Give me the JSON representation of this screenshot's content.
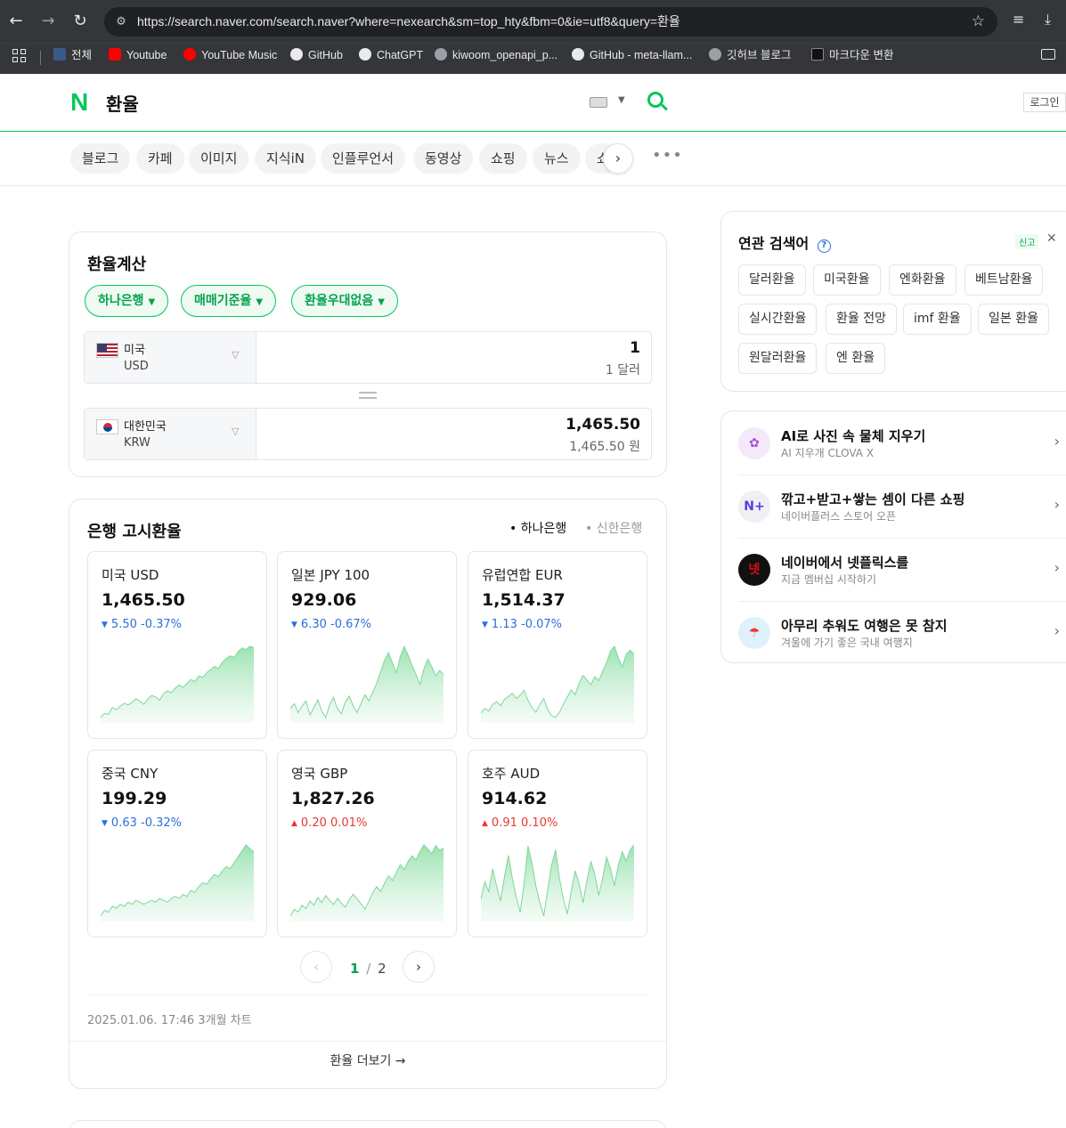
{
  "browser": {
    "url": "https://search.naver.com/search.naver?where=nexearch&sm=top_hty&fbm=0&ie=utf8&query=환율",
    "bookmarks": [
      "전체",
      "Youtube",
      "YouTube Music",
      "GitHub",
      "ChatGPT",
      "kiwoom_openapi_p...",
      "GitHub - meta-llam...",
      "깃허브 블로그",
      "마크다운 변환"
    ]
  },
  "header": {
    "logo": "N",
    "query": "환율",
    "login": "로그인"
  },
  "tabs": [
    "블로그",
    "카페",
    "이미지",
    "지식iN",
    "인플루언서",
    "동영상",
    "쇼핑",
    "뉴스",
    "쇼"
  ],
  "calculator": {
    "title": "환율계산",
    "filters": [
      "하나은행",
      "매매기준율",
      "환율우대없음"
    ],
    "from": {
      "country": "미국",
      "code": "USD",
      "value": "1",
      "sub": "1 달러"
    },
    "to": {
      "country": "대한민국",
      "code": "KRW",
      "value": "1,465.50",
      "sub": "1,465.50 원"
    }
  },
  "bank_rates": {
    "title": "은행 고시환율",
    "banks": [
      "하나은행",
      "신한은행"
    ],
    "active_bank": "하나은행",
    "items": [
      {
        "name": "미국 USD",
        "value": "1,465.50",
        "direction": "down",
        "diff": "5.50",
        "pct": "-0.37%",
        "trend": [
          1333,
          1341,
          1339,
          1352,
          1348,
          1355,
          1360,
          1357,
          1362,
          1369,
          1364,
          1358,
          1368,
          1375,
          1372,
          1366,
          1378,
          1384,
          1380,
          1389,
          1395,
          1390,
          1398,
          1405,
          1401,
          1412,
          1409,
          1418,
          1424,
          1430,
          1426,
          1438,
          1445,
          1450,
          1447,
          1458,
          1465,
          1462,
          1468,
          1465.5
        ]
      },
      {
        "name": "일본 JPY 100",
        "value": "929.06",
        "direction": "down",
        "diff": "6.30",
        "pct": "-0.67%",
        "trend": [
          902,
          906,
          899,
          904,
          908,
          897,
          903,
          909,
          900,
          895,
          905,
          911,
          902,
          898,
          907,
          912,
          904,
          899,
          906,
          913,
          908,
          915,
          922,
          931,
          940,
          946,
          938,
          930,
          943,
          951,
          944,
          936,
          929,
          921,
          933,
          941,
          935,
          928,
          932,
          929
        ]
      },
      {
        "name": "유럽연합 EUR",
        "value": "1,514.37",
        "direction": "down",
        "diff": "1.13",
        "pct": "-0.07%",
        "trend": [
          1425,
          1432,
          1428,
          1438,
          1442,
          1436,
          1446,
          1450,
          1455,
          1447,
          1452,
          1459,
          1444,
          1433,
          1426,
          1438,
          1447,
          1430,
          1421,
          1418,
          1426,
          1438,
          1449,
          1460,
          1453,
          1470,
          1482,
          1475,
          1468,
          1480,
          1474,
          1488,
          1501,
          1519,
          1526,
          1508,
          1495,
          1514,
          1520,
          1514
        ]
      },
      {
        "name": "중국 CNY",
        "value": "199.29",
        "direction": "down",
        "diff": "0.63",
        "pct": "-0.32%",
        "trend": [
          183,
          184.5,
          184,
          185.5,
          185,
          186,
          185.5,
          186.5,
          186,
          187,
          186.5,
          186,
          186.5,
          187,
          186.5,
          187.5,
          187,
          186.5,
          187.5,
          188,
          187.5,
          188.5,
          188,
          189.5,
          189,
          190.5,
          191.5,
          191,
          192.5,
          193.5,
          193,
          194.5,
          195.5,
          195,
          196.5,
          198,
          199.5,
          201,
          200,
          199.3
        ]
      },
      {
        "name": "영국 GBP",
        "value": "1,827.26",
        "direction": "up",
        "diff": "0.20",
        "pct": "0.01%",
        "trend": [
          1728,
          1738,
          1734,
          1744,
          1739,
          1750,
          1744,
          1755,
          1748,
          1758,
          1751,
          1745,
          1754,
          1747,
          1741,
          1752,
          1760,
          1753,
          1746,
          1738,
          1750,
          1762,
          1771,
          1764,
          1776,
          1787,
          1780,
          1792,
          1803,
          1796,
          1808,
          1816,
          1810,
          1822,
          1832,
          1826,
          1819,
          1831,
          1824,
          1827.26
        ]
      },
      {
        "name": "호주 AUD",
        "value": "914.62",
        "direction": "up",
        "diff": "0.91",
        "pct": "0.10%",
        "trend": [
          886,
          895,
          890,
          902,
          893,
          885,
          898,
          909,
          897,
          887,
          879,
          894,
          914,
          905,
          893,
          884,
          877,
          891,
          904,
          912,
          897,
          886,
          878,
          890,
          901,
          894,
          884,
          896,
          906,
          899,
          888,
          897,
          908,
          902,
          893,
          904,
          911,
          906,
          912,
          914.62
        ]
      }
    ],
    "page_current": "1",
    "page_sep": "/",
    "page_total": "2",
    "footer_date": "2025.01.06. 17:46 3개월 차트",
    "more_link": "환율 더보기 →"
  },
  "related": {
    "title": "연관 검색어",
    "report": "신고",
    "keywords": [
      "달러환율",
      "미국환율",
      "엔화환율",
      "베트남환율",
      "실시간환율",
      "환율 전망",
      "imf 환율",
      "일본 환율",
      "원달러환율",
      "엔 환율"
    ]
  },
  "promos": [
    {
      "title": "AI로 사진 속 물체 지우기",
      "sub": "AI 지우개 CLOVA X",
      "icon": "clova-x-icon"
    },
    {
      "title": "깎고+받고+쌓는 셈이 다른 쇼핑",
      "sub": "네이버플러스 스토어 오픈",
      "icon": "naver-plus-icon"
    },
    {
      "title": "네이버에서 넷플릭스를",
      "sub": "지금 멤버십 시작하기",
      "icon": "netflix-icon"
    },
    {
      "title": "아무리 추워도 여행은 못 참지",
      "sub": "겨울에 가기 좋은 국내 여행지",
      "icon": "travel-icon"
    }
  ],
  "colors": {
    "naver_green": "#03c75a",
    "down_blue": "#2a6fdb",
    "up_red": "#e9382f"
  }
}
